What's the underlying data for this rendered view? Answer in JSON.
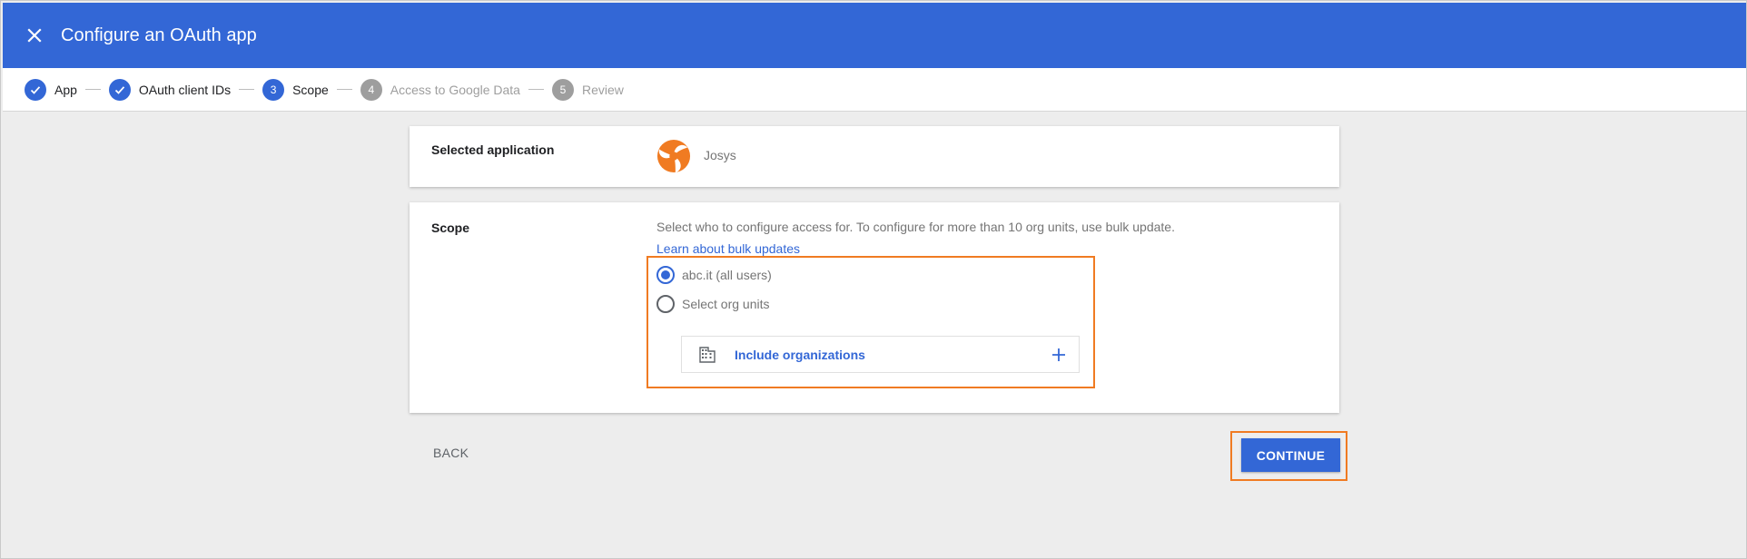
{
  "header": {
    "title": "Configure an OAuth app",
    "close_icon": "close-icon",
    "color": "#3367d6"
  },
  "stepper": [
    {
      "number": "1",
      "label": "App",
      "state": "done"
    },
    {
      "number": "2",
      "label": "OAuth client IDs",
      "state": "done"
    },
    {
      "number": "3",
      "label": "Scope",
      "state": "active"
    },
    {
      "number": "4",
      "label": "Access to Google Data",
      "state": "pending"
    },
    {
      "number": "5",
      "label": "Review",
      "state": "pending"
    }
  ],
  "selected_app": {
    "label": "Selected application",
    "name": "Josys",
    "logo_icon": "josys-logo-icon",
    "logo_color": "#f07b22"
  },
  "scope": {
    "label": "Scope",
    "description": "Select who to configure access for. To configure for more than 10 org units, use bulk update.",
    "link": "Learn about bulk updates",
    "options": [
      {
        "label": "abc.it (all users)",
        "checked": true
      },
      {
        "label": "Select org units",
        "checked": false
      }
    ],
    "include_orgs": {
      "label": "Include organizations",
      "icon": "building-icon",
      "add_icon": "plus-icon"
    }
  },
  "footer": {
    "back_label": "BACK",
    "continue_label": "CONTINUE"
  },
  "highlight_color": "#f07b22"
}
